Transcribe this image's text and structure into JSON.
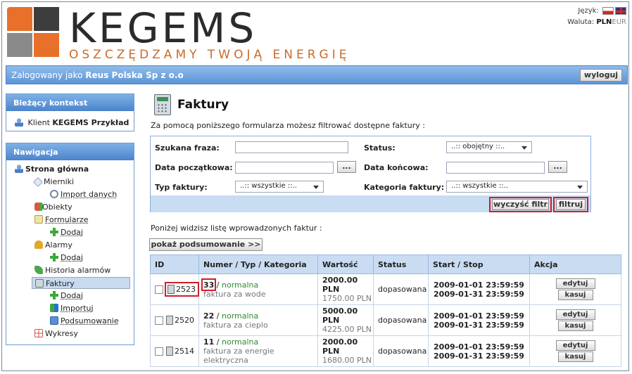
{
  "header": {
    "brand": "KEGEMS",
    "tagline": "OSZCZĘDZAMY TWOJĄ ENERGIĘ",
    "language_label": "Język:",
    "currency_label": "Waluta:",
    "currency_active": "PLN",
    "currency_other": "EUR"
  },
  "loginbar": {
    "prefix": "Zalogowany jako",
    "user": "Reus Polska Sp z o.o",
    "logout_label": "wyloguj"
  },
  "context": {
    "title": "Bieżący kontekst",
    "client_prefix": "Klient",
    "client_name": "KEGEMS Przykład"
  },
  "nav": {
    "title": "Nawigacja",
    "home": "Strona główna",
    "meters": "Mierniki",
    "import_data": "Import danych",
    "objects": "Obiekty",
    "forms": "Formularze",
    "forms_add": "Dodaj",
    "alarms": "Alarmy",
    "alarms_add": "Dodaj",
    "alarm_history": "Historia alarmów",
    "invoices": "Faktury",
    "invoices_add": "Dodaj",
    "invoices_import": "Importuj",
    "invoices_summary": "Podsumowanie",
    "charts": "Wykresy"
  },
  "main": {
    "title": "Faktury",
    "intro": "Za pomocą poniższego formularza możesz filtrować dostępne faktury :",
    "list_info": "Poniżej widzisz listę wprowadzonych faktur :",
    "summary_button": "pokaż podsumowanie >>"
  },
  "filter": {
    "search_label": "Szukana fraza:",
    "search_value": "",
    "status_label": "Status:",
    "status_value": "..:: obojętny ::..",
    "date_start_label": "Data początkowa:",
    "date_start_value": "",
    "date_end_label": "Data końcowa:",
    "date_end_value": "",
    "picker_label": "...",
    "type_label": "Typ faktury:",
    "type_value": "..:: wszystkie ::..",
    "category_label": "Kategoria faktury:",
    "category_value": "..:: wszystkie ::..",
    "clear_button": "wyczyść filtr",
    "apply_button": "filtruj"
  },
  "table": {
    "headers": [
      "ID",
      "Numer / Typ / Kategoria",
      "Wartość",
      "Status",
      "Start / Stop",
      "Akcja"
    ],
    "edit_label": "edytuj",
    "delete_label": "kasuj",
    "rows": [
      {
        "id": "2523",
        "number": "33",
        "type": "normalna",
        "category": "faktura za wode",
        "value": "2000.00 PLN",
        "value2": "1750.00 PLN",
        "status": "dopasowana",
        "start": "2009-01-01 23:59:59",
        "stop": "2009-01-31 23:59:59"
      },
      {
        "id": "2520",
        "number": "22",
        "type": "normalna",
        "category": "faktura za cieplo",
        "value": "5000.00 PLN",
        "value2": "4225.00 PLN",
        "status": "dopasowana",
        "start": "2009-01-01 23:59:59",
        "stop": "2009-01-31 23:59:59"
      },
      {
        "id": "2514",
        "number": "11",
        "type": "normalna",
        "category": "faktura za energie elektryczna",
        "value": "2000.00 PLN",
        "value2": "1680.00 PLN",
        "status": "dopasowana",
        "start": "2009-01-01 23:59:59",
        "stop": "2009-01-31 23:59:59"
      }
    ]
  },
  "colors": {
    "accent_blue": "#5d95d6",
    "tag_orange": "#c96a2a",
    "highlight_red": "#cc1f2b",
    "type_green": "#2f8a2f"
  }
}
